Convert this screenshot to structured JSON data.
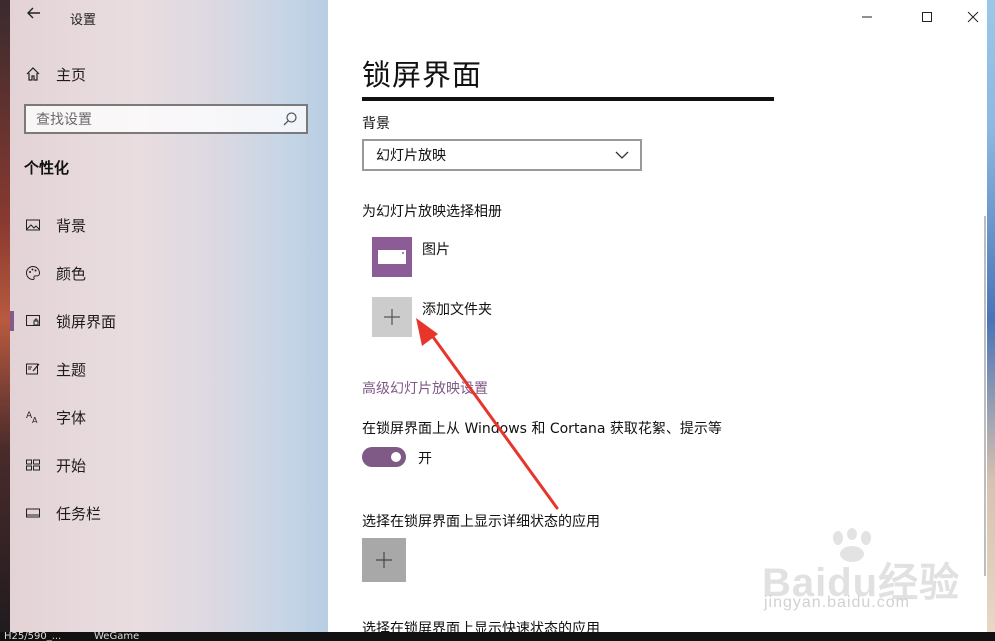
{
  "app": {
    "title": "设置"
  },
  "window_controls": {
    "minimize": "minimize-icon",
    "maximize": "maximize-icon",
    "close": "close-icon"
  },
  "sidebar": {
    "home": "主页",
    "search_placeholder": "查找设置",
    "section": "个性化",
    "items": [
      {
        "label": "背景",
        "icon": "picture-icon"
      },
      {
        "label": "颜色",
        "icon": "palette-icon"
      },
      {
        "label": "锁屏界面",
        "icon": "lock-screen-icon",
        "active": true
      },
      {
        "label": "主题",
        "icon": "theme-icon"
      },
      {
        "label": "字体",
        "icon": "font-icon"
      },
      {
        "label": "开始",
        "icon": "start-icon"
      },
      {
        "label": "任务栏",
        "icon": "taskbar-icon"
      }
    ]
  },
  "main": {
    "title": "锁屏界面",
    "background_label": "背景",
    "background_value": "幻灯片放映",
    "album_label": "为幻灯片放映选择相册",
    "albums": [
      {
        "name": "图片",
        "icon": "folder-icon"
      },
      {
        "name": "添加文件夹",
        "icon": "plus-icon"
      }
    ],
    "advanced_link": "高级幻灯片放映设置",
    "tips_label": "在锁屏界面上从 Windows 和 Cortana 获取花絮、提示等",
    "tips_toggle": {
      "state": "开",
      "on": true
    },
    "detail_status_label": "选择在锁屏界面上显示详细状态的应用",
    "quick_status_label": "选择在锁屏界面上显示快速状态的应用"
  },
  "colors": {
    "accent": "#835a8a",
    "annotation": "#e8352c"
  },
  "taskbar": {
    "item1": "H25/590_...",
    "item2": "WeGame"
  },
  "watermark": {
    "brand": "Baidu经验",
    "site": "jingyan.baidu.com"
  }
}
